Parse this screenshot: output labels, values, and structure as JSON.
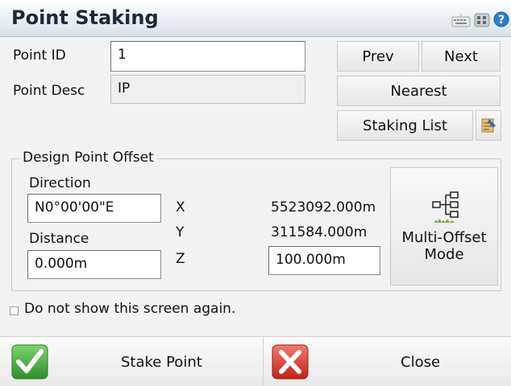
{
  "window": {
    "title": "Point Staking",
    "icons": [
      "keyboard-icon",
      "grid-icon",
      "help-icon"
    ]
  },
  "point": {
    "id_label": "Point ID",
    "id_value": "1",
    "desc_label": "Point Desc",
    "desc_value": "IP"
  },
  "nav": {
    "prev_label": "Prev",
    "next_label": "Next",
    "nearest_label": "Nearest",
    "staking_list_label": "Staking List"
  },
  "offset": {
    "group_label": "Design Point Offset",
    "direction_label": "Direction",
    "direction_value": "N0°00'00\"E",
    "distance_label": "Distance",
    "distance_value": "0.000m",
    "x_label": "X",
    "x_value": "5523092.000m",
    "y_label": "Y",
    "y_value": "311584.000m",
    "z_label": "Z",
    "z_value": "100.000m",
    "multi_offset_line1": "Multi-Offset",
    "multi_offset_line2": "Mode"
  },
  "options": {
    "dont_show_label": "Do not show this screen again."
  },
  "actions": {
    "stake_label": "Stake Point",
    "close_label": "Close"
  },
  "colors": {
    "accent_green": "#3aa334",
    "accent_red": "#d9342b",
    "title_color": "#1c2a38"
  }
}
